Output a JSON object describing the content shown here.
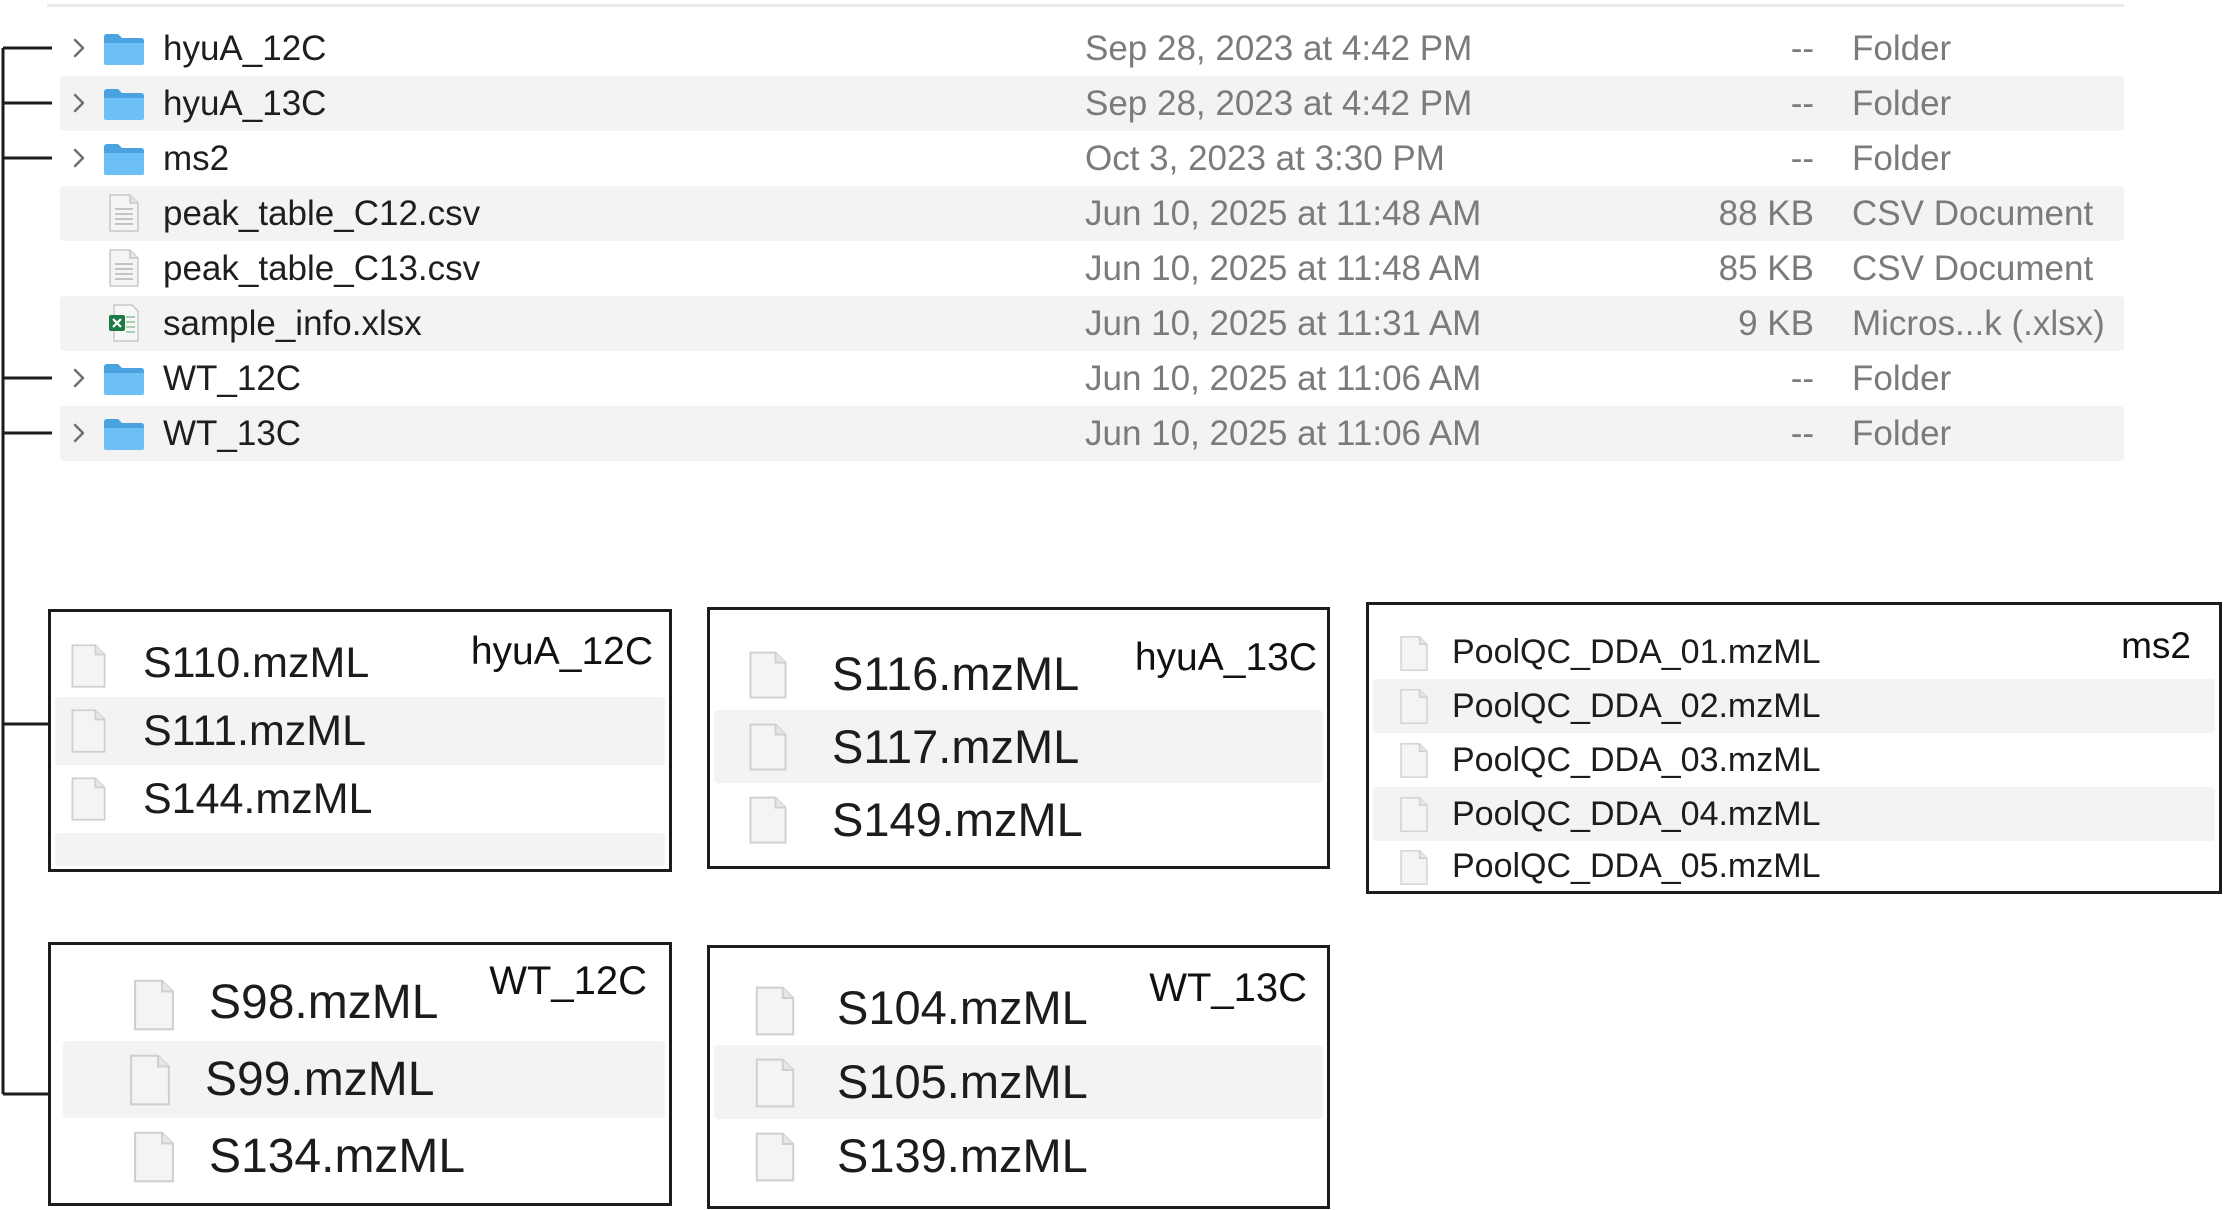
{
  "list": {
    "rows": [
      {
        "name": "hyuA_12C",
        "date": "Sep 28, 2023 at 4:42 PM",
        "size": "--",
        "kind": "Folder"
      },
      {
        "name": "hyuA_13C",
        "date": "Sep 28, 2023 at 4:42 PM",
        "size": "--",
        "kind": "Folder"
      },
      {
        "name": "ms2",
        "date": "Oct 3, 2023 at 3:30 PM",
        "size": "--",
        "kind": "Folder"
      },
      {
        "name": "peak_table_C12.csv",
        "date": "Jun 10, 2025 at 11:48 AM",
        "size": "88 KB",
        "kind": "CSV Document"
      },
      {
        "name": "peak_table_C13.csv",
        "date": "Jun 10, 2025 at 11:48 AM",
        "size": "85 KB",
        "kind": "CSV Document"
      },
      {
        "name": "sample_info.xlsx",
        "date": "Jun 10, 2025 at 11:31 AM",
        "size": "9 KB",
        "kind": "Micros...k (.xlsx)"
      },
      {
        "name": "WT_12C",
        "date": "Jun 10, 2025 at 11:06 AM",
        "size": "--",
        "kind": "Folder"
      },
      {
        "name": "WT_13C",
        "date": "Jun 10, 2025 at 11:06 AM",
        "size": "--",
        "kind": "Folder"
      }
    ]
  },
  "panels": {
    "hyua12c": {
      "title": "hyuA_12C",
      "files": [
        "S110.mzML",
        "S111.mzML",
        "S144.mzML"
      ]
    },
    "hyua13c": {
      "title": "hyuA_13C",
      "files": [
        "S116.mzML",
        "S117.mzML",
        "S149.mzML"
      ]
    },
    "ms2": {
      "title": "ms2",
      "files": [
        "PoolQC_DDA_01.mzML",
        "PoolQC_DDA_02.mzML",
        "PoolQC_DDA_03.mzML",
        "PoolQC_DDA_04.mzML",
        "PoolQC_DDA_05.mzML"
      ]
    },
    "wt12c": {
      "title": "WT_12C",
      "files": [
        "S98.mzML",
        "S99.mzML",
        "S134.mzML"
      ]
    },
    "wt13c": {
      "title": "WT_13C",
      "files": [
        "S104.mzML",
        "S105.mzML",
        "S139.mzML"
      ]
    }
  },
  "icons": {
    "folder": "folder-icon",
    "csv": "csv-document-icon",
    "xlsx": "excel-document-icon",
    "generic": "generic-document-icon",
    "disclosure": "chevron-right-icon"
  },
  "colors": {
    "folder": "#5ab4f0",
    "excel": "#1d7a45",
    "secondary_text": "#7b7b7b",
    "row_stripe": "#f3f3f3"
  }
}
